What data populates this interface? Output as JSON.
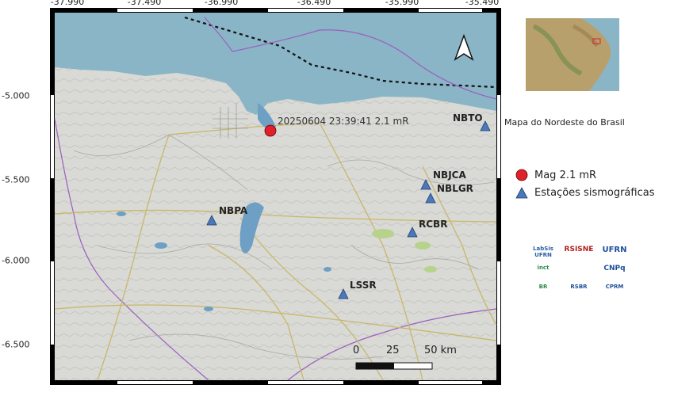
{
  "map": {
    "top_ticks": [
      "-37.990",
      "-37.490",
      "-36.990",
      "-36.490",
      "-35.990",
      "-35.490"
    ],
    "left_ticks": [
      "-5.000",
      "-5.500",
      "-6.000",
      "-6.500"
    ],
    "event_label": "20250604 23:39:41 2.1 mR",
    "stations": [
      {
        "code": "NBTO"
      },
      {
        "code": "NBJCA"
      },
      {
        "code": "NBLGR"
      },
      {
        "code": "NBPA"
      },
      {
        "code": "RCBR"
      },
      {
        "code": "LSSR"
      }
    ],
    "scale_labels": [
      "0",
      "25",
      "50 km"
    ]
  },
  "inset_caption": "Mapa do  Nordeste do Brasil",
  "legend": {
    "event": "Mag 2.1 mR",
    "stations": "Estações sismográficas"
  },
  "logos": [
    "LabSis UFRN",
    "RSISNE",
    "UFRN",
    "inct",
    "CNPq",
    "BR",
    "RSBR",
    "CPRM"
  ],
  "colors": {
    "sea": "#8ab5c6",
    "land": "#d8d8d4",
    "event": "#e0202a",
    "station": "#4a78b8",
    "roads": "#c8b86a"
  }
}
